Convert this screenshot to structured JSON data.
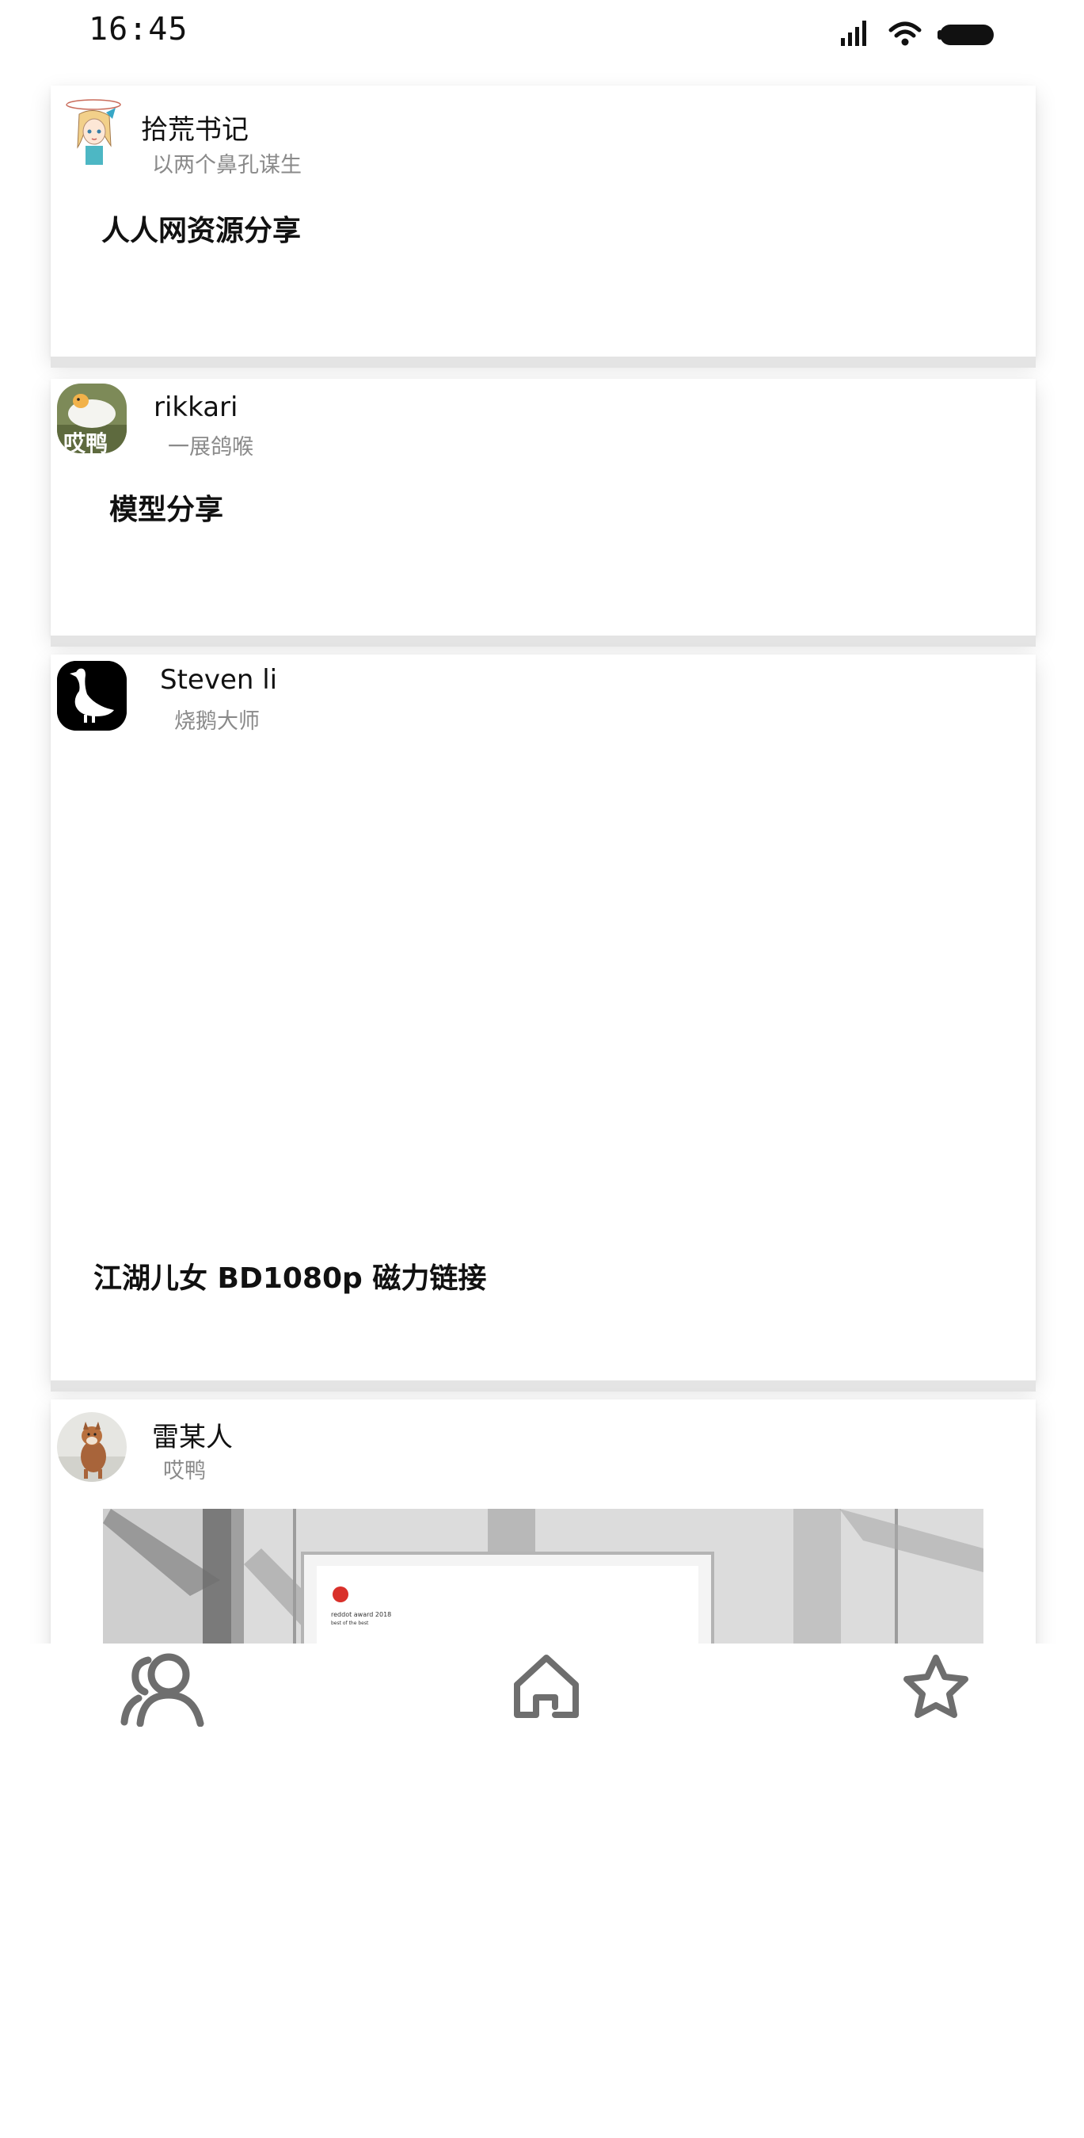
{
  "status_bar": {
    "time": "16:45",
    "icons": [
      "cellular-signal-icon",
      "wifi-icon",
      "battery-icon"
    ]
  },
  "posts": [
    {
      "author": "拾荒书记",
      "subtitle": "以两个鼻孔谋生",
      "title": "人人网资源分享",
      "avatar": "anime-girl-avatar"
    },
    {
      "author": "rikkari",
      "subtitle": "一展鸽喉",
      "title": "模型分享",
      "avatar": "duck-avatar",
      "avatar_text": "哎鸭"
    },
    {
      "author": "Steven li",
      "subtitle": "烧鹅大师",
      "title": "江湖儿女 BD1080p 磁力链接",
      "avatar": "goose-avatar"
    },
    {
      "author": "雷某人",
      "subtitle": "哎鸭",
      "title": "",
      "avatar": "shiba-dog-avatar",
      "image": "framed-poster-photo",
      "image_caption": "reddot award 2018 best of the best"
    }
  ],
  "tab_bar": {
    "tabs": [
      {
        "icon": "users-icon"
      },
      {
        "icon": "home-icon"
      },
      {
        "icon": "star-icon"
      }
    ]
  },
  "colors": {
    "background": "#ffffff",
    "text": "#111111",
    "subtitle": "#8a8a8a",
    "icon": "#6e6e6e",
    "divider": "#e4e4e4"
  }
}
